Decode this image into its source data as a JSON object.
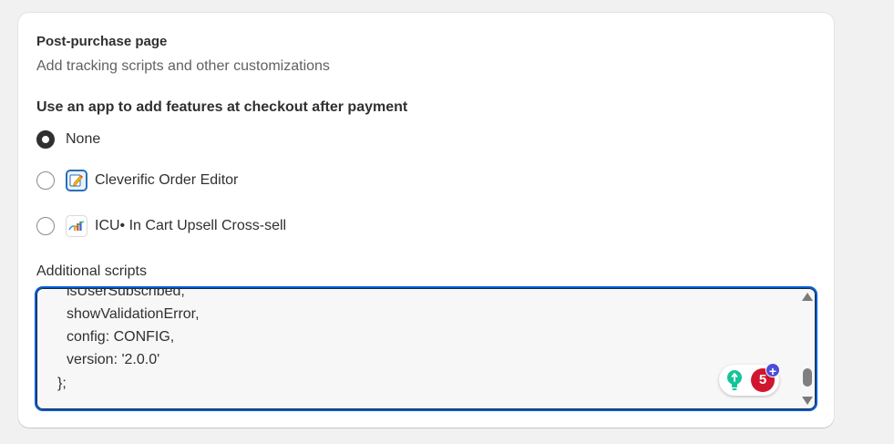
{
  "section": {
    "title": "Post-purchase page",
    "subtitle": "Add tracking scripts and other customizations"
  },
  "app_question": "Use an app to add features at checkout after payment",
  "options": [
    {
      "label": "None",
      "selected": true,
      "icon": null
    },
    {
      "label": "Cleverific Order Editor",
      "selected": false,
      "icon": "cleverific-app-icon"
    },
    {
      "label": "ICU• In Cart Upsell Cross-sell",
      "selected": false,
      "icon": "icu-app-icon"
    }
  ],
  "additional_scripts": {
    "label": "Additional scripts",
    "lines": [
      "isUserSubscribed,",
      "showValidationError,",
      "config: CONFIG,",
      "version: '2.0.0'",
      "};"
    ]
  },
  "grammarly": {
    "count": "5",
    "plus": "+"
  },
  "colors": {
    "focus_border": "#005bd3",
    "grammarly_red": "#d0162f",
    "grammarly_green": "#15c39a",
    "grammarly_purple": "#4a4ed8"
  }
}
